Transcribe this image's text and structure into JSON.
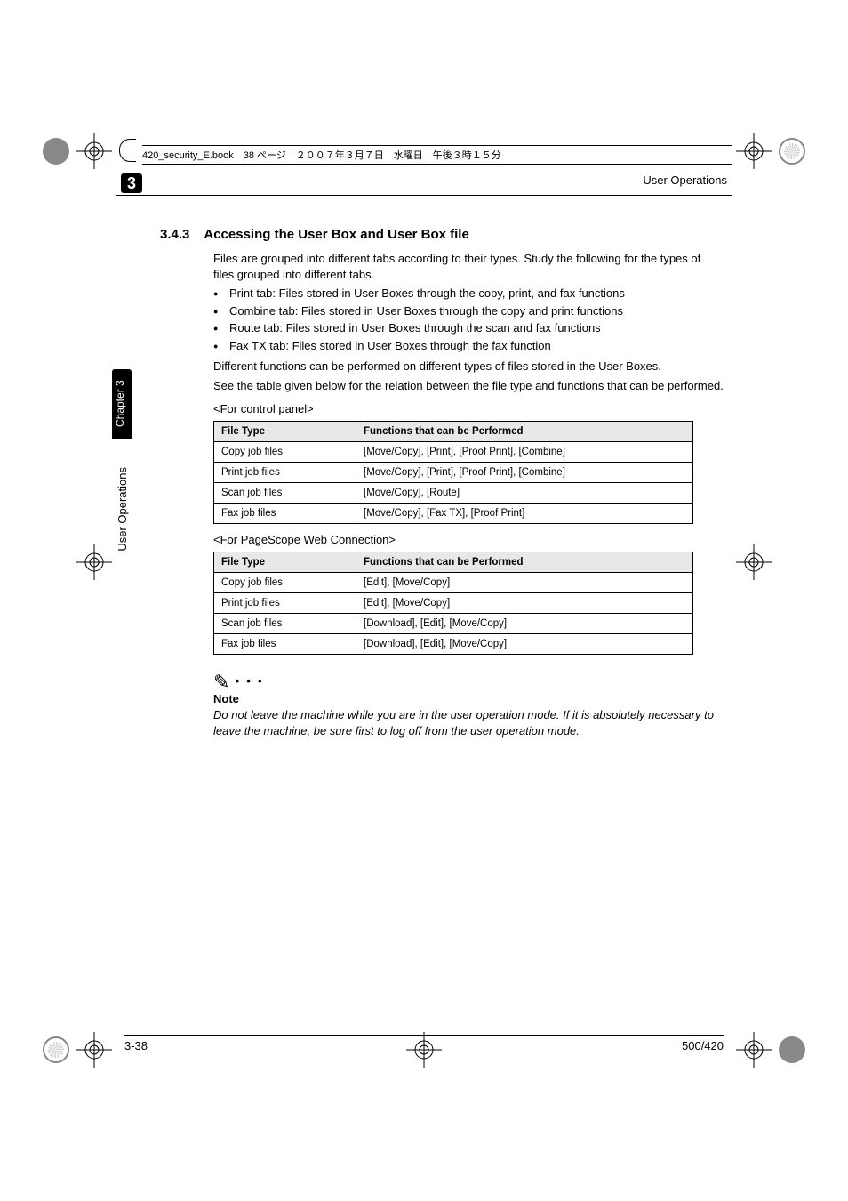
{
  "book_header": "420_security_E.book　38 ページ　２００７年３月７日　水曜日　午後３時１５分",
  "running_header": "User Operations",
  "chapter_num": "3",
  "side_chapter": "Chapter 3",
  "side_section": "User Operations",
  "section_number": "3.4.3",
  "section_title": "Accessing the User Box and User Box file",
  "intro": "Files are grouped into different tabs according to their types. Study the following for the types of files grouped into different tabs.",
  "bullets": [
    "Print tab: Files stored in User Boxes through the copy, print, and fax functions",
    "Combine tab: Files stored in User Boxes through the copy and print functions",
    "Route tab: Files stored in User Boxes through the scan and fax functions",
    "Fax TX tab: Files stored in User Boxes through the fax function"
  ],
  "para2a": "Different functions can be performed on different types of files stored in the User Boxes.",
  "para2b": "See the table given below for the relation between the file type and functions that can be performed.",
  "subhead1": "<For control panel>",
  "table1": {
    "headers": [
      "File Type",
      "Functions that can be Performed"
    ],
    "rows": [
      [
        "Copy job files",
        "[Move/Copy], [Print], [Proof Print], [Combine]"
      ],
      [
        "Print job files",
        "[Move/Copy], [Print], [Proof Print], [Combine]"
      ],
      [
        "Scan job files",
        "[Move/Copy], [Route]"
      ],
      [
        "Fax job files",
        "[Move/Copy], [Fax TX], [Proof Print]"
      ]
    ]
  },
  "subhead2": "<For PageScope Web Connection>",
  "table2": {
    "headers": [
      "File Type",
      "Functions that can be Performed"
    ],
    "rows": [
      [
        "Copy job files",
        "[Edit], [Move/Copy]"
      ],
      [
        "Print job files",
        "[Edit], [Move/Copy]"
      ],
      [
        "Scan job files",
        "[Download], [Edit], [Move/Copy]"
      ],
      [
        "Fax job files",
        "[Download], [Edit], [Move/Copy]"
      ]
    ]
  },
  "note_label": "Note",
  "note_text": "Do not leave the machine while you are in the user operation mode. If it is absolutely necessary to leave the machine, be sure first to log off from the user operation mode.",
  "footer_left": "3-38",
  "footer_right": "500/420"
}
